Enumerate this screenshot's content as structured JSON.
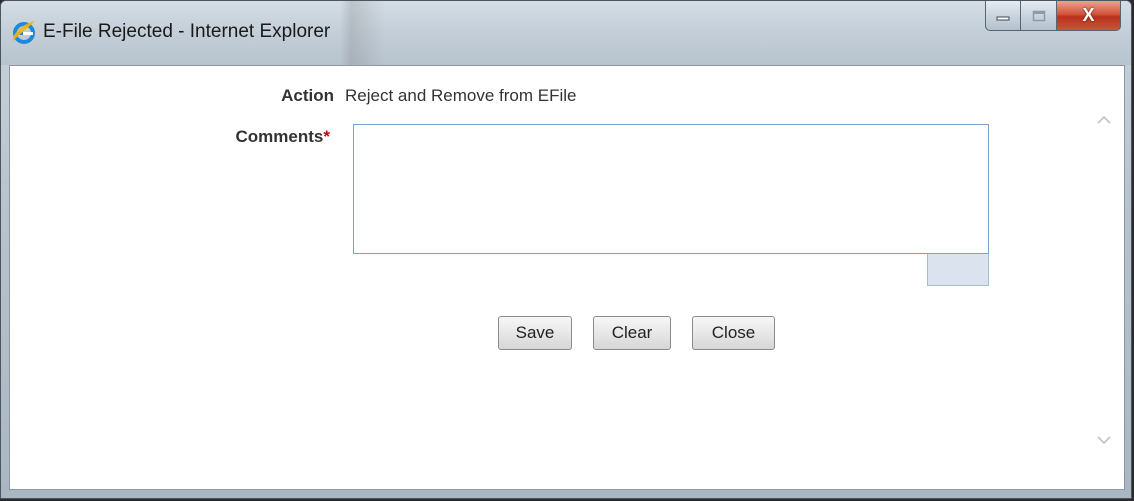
{
  "window": {
    "title": "E-File Rejected - Internet Explorer",
    "icon": "internet-explorer-icon",
    "controls": [
      "minimize-icon",
      "maximize-icon",
      "close-icon"
    ],
    "close_glyph": "X"
  },
  "form": {
    "action_label": "Action",
    "action_value": "Reject and Remove from EFile",
    "comments_label": "Comments",
    "required_marker": "*",
    "comments_value": ""
  },
  "buttons": {
    "save": "Save",
    "clear": "Clear",
    "close": "Close"
  },
  "colors": {
    "required": "#cc0000",
    "close_button": "#c8422a",
    "input_border": "#7fa2c4"
  }
}
